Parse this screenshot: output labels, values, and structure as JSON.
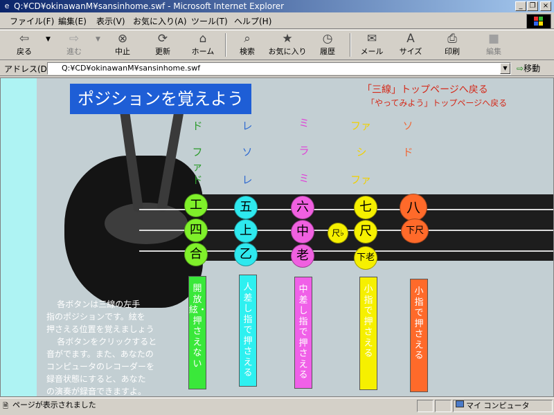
{
  "window": {
    "title": "Q:¥CD¥okinawanM¥sansinhome.swf - Microsoft Internet Explorer",
    "icon": "ie-icon"
  },
  "menu": [
    "ファイル(F)",
    "編集(E)",
    "表示(V)",
    "お気に入り(A)",
    "ツール(T)",
    "ヘルプ(H)"
  ],
  "toolbar": [
    {
      "label": "戻る",
      "icon": "back-arrow-icon",
      "disabled": false
    },
    {
      "label": "進む",
      "icon": "forward-arrow-icon",
      "disabled": true
    },
    {
      "label": "中止",
      "icon": "stop-icon",
      "disabled": false
    },
    {
      "label": "更新",
      "icon": "refresh-icon",
      "disabled": false
    },
    {
      "label": "ホーム",
      "icon": "home-icon",
      "disabled": false
    },
    {
      "label": "検索",
      "icon": "search-icon",
      "disabled": false
    },
    {
      "label": "お気に入り",
      "icon": "favorites-icon",
      "disabled": false
    },
    {
      "label": "履歴",
      "icon": "history-icon",
      "disabled": false
    },
    {
      "label": "メール",
      "icon": "mail-icon",
      "disabled": false
    },
    {
      "label": "サイズ",
      "icon": "font-size-icon",
      "disabled": false
    },
    {
      "label": "印刷",
      "icon": "print-icon",
      "disabled": false
    },
    {
      "label": "編集",
      "icon": "edit-icon",
      "disabled": true
    }
  ],
  "address": {
    "label": "アドレス(D)",
    "value": "Q:¥CD¥okinawanM¥sansinhome.swf",
    "go_label": "移動"
  },
  "page": {
    "title": "ポジションを覚えよう",
    "link_top": "「三線」トップページへ戻る",
    "link_try": "「やってみよう」トップページへ戻る",
    "note_columns": [
      {
        "color": "#2a9a2a",
        "notes": [
          "ド",
          "ファ",
          "ド"
        ]
      },
      {
        "color": "#2f6ad0",
        "notes": [
          "レ",
          "ソ",
          "レ"
        ]
      },
      {
        "color": "#e040d8",
        "notes": [
          "ミ",
          "ラ",
          "ミ"
        ]
      },
      {
        "color": "#f0d000",
        "notes": [
          "ファ",
          "シ",
          "ファ"
        ]
      },
      {
        "color": "#ee6a3a",
        "notes": [
          "ソ",
          "ド"
        ]
      }
    ],
    "buttons": [
      {
        "label": "工",
        "color": "#7ff02a"
      },
      {
        "label": "四",
        "color": "#7ff02a"
      },
      {
        "label": "合",
        "color": "#7ff02a"
      },
      {
        "label": "五",
        "color": "#2ee8ee"
      },
      {
        "label": "上",
        "color": "#2ee8ee"
      },
      {
        "label": "乙",
        "color": "#2ee8ee"
      },
      {
        "label": "六",
        "color": "#f060e0"
      },
      {
        "label": "中",
        "color": "#f060e0"
      },
      {
        "label": "老",
        "color": "#f060e0"
      },
      {
        "label": "尺♭",
        "color": "#f6f000"
      },
      {
        "label": "七",
        "color": "#f6f000"
      },
      {
        "label": "尺",
        "color": "#f6f000"
      },
      {
        "label": "下老",
        "color": "#f6f000"
      },
      {
        "label": "八",
        "color": "#ff6a2a"
      },
      {
        "label": "下尺",
        "color": "#ff6a2a"
      }
    ],
    "finger_labels": [
      {
        "text": "開放絃・押さえない",
        "color": "#3ae83a"
      },
      {
        "text": "人差し指で押さえる",
        "color": "#2ef0f0"
      },
      {
        "text": "中差し指で押さえる",
        "color": "#f060e8"
      },
      {
        "text": "小指で押さえる",
        "color": "#f6f000"
      },
      {
        "text": "小指で押さえる",
        "color": "#ff6a2a"
      }
    ],
    "instructions": "    各ボタンは三線の左手\n指のポジションです。絃を\n押さえる位置を覚えましょう\n    各ボタンをクリックすると\n音がでます。また、あなたの\nコンピュータのレコーダーを\n録音状態にすると、あなた\nの演奏が録音できますよ。"
  },
  "status": {
    "text": "ページが表示されました",
    "zone": "マイ コンピュータ"
  }
}
